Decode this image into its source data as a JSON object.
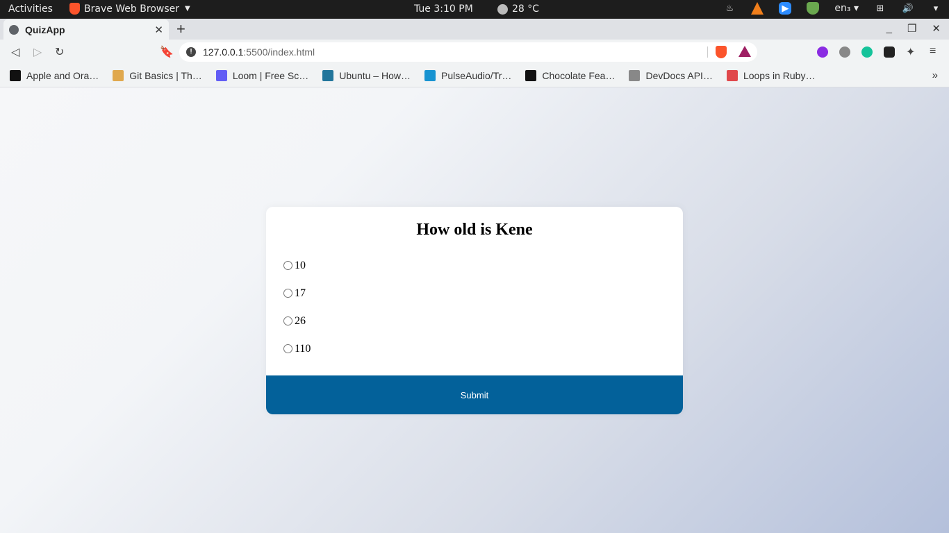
{
  "system_bar": {
    "activities": "Activities",
    "app_name": "Brave Web Browser",
    "clock": "Tue  3:10 PM",
    "weather": "28 °C",
    "language": "en₃"
  },
  "browser": {
    "tab": {
      "title": "QuizApp"
    },
    "address": {
      "host": "127.0.0.1",
      "path": ":5500/index.html"
    },
    "bookmarks": [
      {
        "label": "Apple and Ora…",
        "icon": "hackerrank-icon",
        "color": "#111111"
      },
      {
        "label": "Git Basics | Th…",
        "icon": "odin-icon",
        "color": "#e0a84d"
      },
      {
        "label": "Loom | Free Sc…",
        "icon": "loom-icon",
        "color": "#625df5"
      },
      {
        "label": "Ubuntu – How…",
        "icon": "wordpress-icon",
        "color": "#21759b"
      },
      {
        "label": "PulseAudio/Tr…",
        "icon": "archlinux-icon",
        "color": "#1793d1"
      },
      {
        "label": "Chocolate Fea…",
        "icon": "hackerrank-icon",
        "color": "#111111"
      },
      {
        "label": "DevDocs API…",
        "icon": "devdocs-icon",
        "color": "#888888"
      },
      {
        "label": "Loops in Ruby…",
        "icon": "ruby-icon",
        "color": "#e0484b"
      }
    ]
  },
  "quiz": {
    "question": "How old is Kene",
    "answers": [
      "10",
      "17",
      "26",
      "110"
    ],
    "submit_label": "Submit",
    "submit_color": "#03619a"
  }
}
